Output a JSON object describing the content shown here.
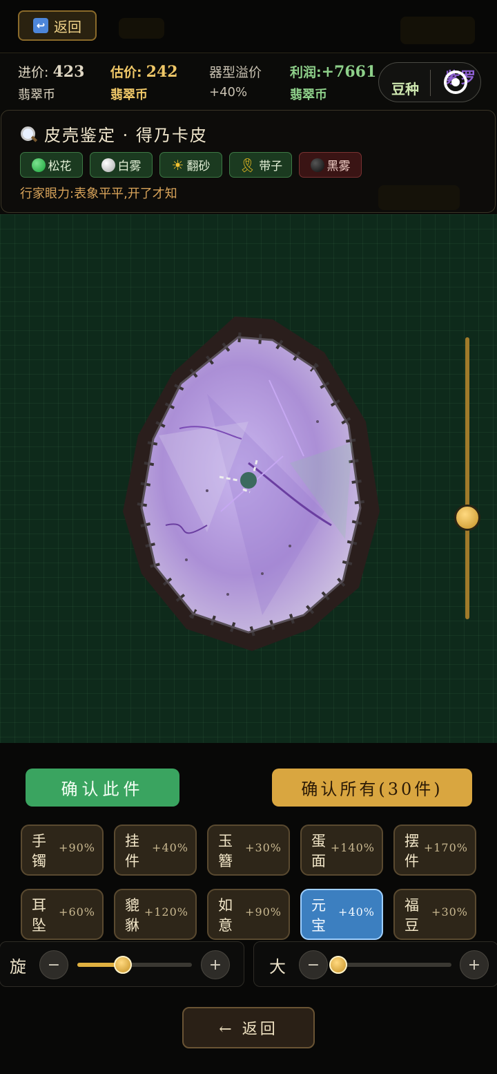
{
  "header": {
    "back_label": "返回"
  },
  "stats": {
    "cost_label": "进价:",
    "cost_value": "423",
    "cost_unit": "翡翠币",
    "estimate_label": "估价:",
    "estimate_value": "242",
    "estimate_unit": "翡翠币",
    "premium_label": "器型溢价",
    "premium_value": "+40%",
    "profit_label": "利润:",
    "profit_value": "+7661",
    "profit_unit": "翡翠币"
  },
  "mode_toggle": {
    "left": "豆种",
    "right": "紫罗"
  },
  "appraisal": {
    "title": "皮壳鉴定 · 得乃卡皮",
    "tags": [
      {
        "label": "松花",
        "color": "#22b844"
      },
      {
        "label": "白雾",
        "color": "#e8e8e8"
      },
      {
        "label": "翻砂",
        "color": "#f2c230"
      },
      {
        "label": "带子",
        "color": "#e6b820"
      },
      {
        "label": "黑雾",
        "color": "#1a1a1a"
      }
    ],
    "hint": "行家眼力:表象平平,开了才知"
  },
  "stone": {
    "colors": {
      "skin": "#2a1e1c",
      "flesh": "#b49ad8",
      "rind": "#2e2824"
    }
  },
  "actions": {
    "confirm_one": "确认此件",
    "confirm_all": "确认所有(30件)"
  },
  "shapes": [
    {
      "name": "手镯",
      "premium": "+90%"
    },
    {
      "name": "挂件",
      "premium": "+40%"
    },
    {
      "name": "玉簪",
      "premium": "+30%"
    },
    {
      "name": "蛋面",
      "premium": "+140%"
    },
    {
      "name": "摆件",
      "premium": "+170%"
    },
    {
      "name": "耳坠",
      "premium": "+60%"
    },
    {
      "name": "貔貅",
      "premium": "+120%"
    },
    {
      "name": "如意",
      "premium": "+90%"
    },
    {
      "name": "元宝",
      "premium": "+40%",
      "selected": true
    },
    {
      "name": "福豆",
      "premium": "+30%"
    }
  ],
  "controls": {
    "rotate_label": "旋",
    "rotate_level": 0.4,
    "size_label": "大",
    "size_level": 0.06,
    "minus": "−",
    "plus": "+"
  },
  "footer": {
    "back_label": "← 返回"
  },
  "zoom_level": 0.36
}
